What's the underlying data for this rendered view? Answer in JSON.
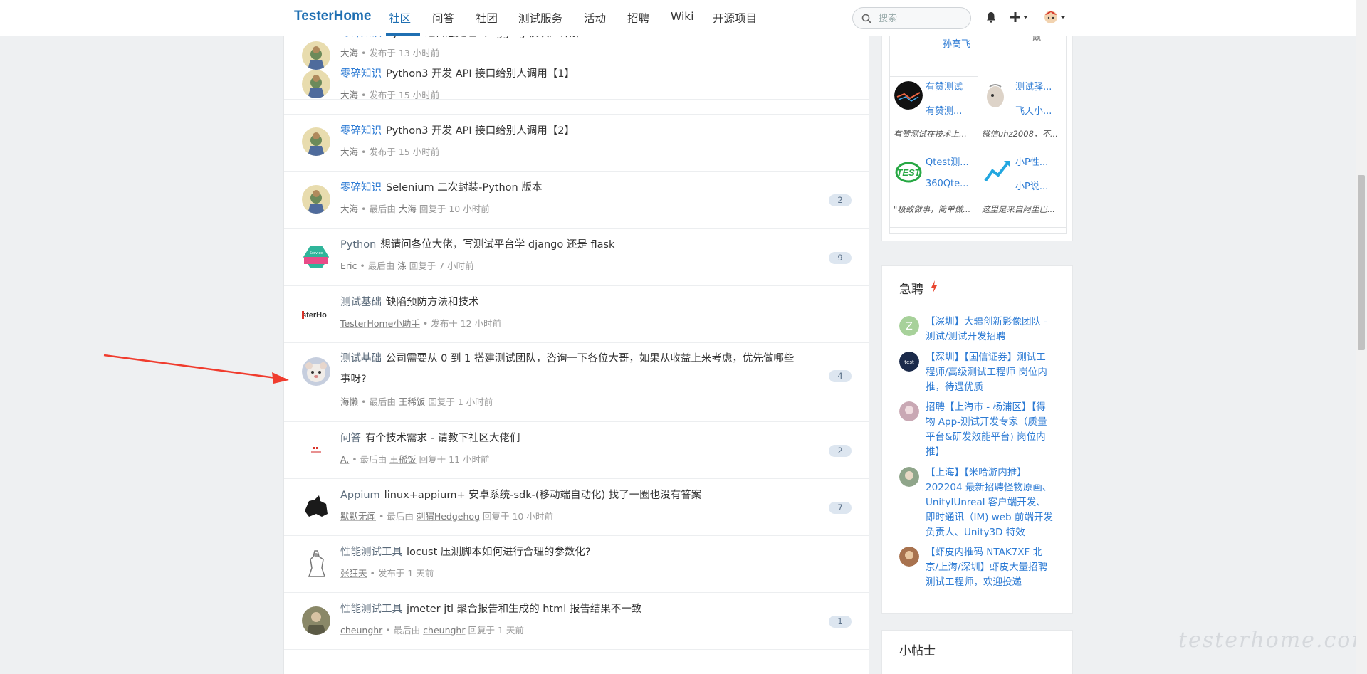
{
  "nav": {
    "brand": "TesterHome",
    "items": [
      "社区",
      "问答",
      "社团",
      "测试服务",
      "活动",
      "招聘",
      "Wiki",
      "开源项目"
    ],
    "search_placeholder": "搜索"
  },
  "topics": [
    {
      "node": "零碎知识",
      "node_style": "blue",
      "title": "Python 之日志处理（logging 模块）详解",
      "author": "大海",
      "meta": "发布于 13 小时前",
      "count": ""
    },
    {
      "node": "零碎知识",
      "node_style": "blue",
      "title": "Python3 开发 API 接口给别人调用【1】",
      "author": "大海",
      "meta": "发布于 15 小时前",
      "count": ""
    },
    {
      "node": "零碎知识",
      "node_style": "blue",
      "title": "Python3 开发 API 接口给别人调用【2】",
      "author": "大海",
      "meta": "发布于 15 小时前",
      "count": ""
    },
    {
      "node": "零碎知识",
      "node_style": "blue",
      "title": "Selenium 二次封装-Python 版本",
      "author": "大海",
      "last_reply_prefix": "最后由",
      "last_user": "大海",
      "meta": "回复于 10 小时前",
      "count": "2"
    },
    {
      "node": "Python",
      "node_style": "gray",
      "title": "想请问各位大佬，写测试平台学 django 还是 flask",
      "author": "Eric",
      "last_reply_prefix": "最后由",
      "last_user": "涤",
      "meta": "回复于 7 小时前",
      "count": "9"
    },
    {
      "node": "测试基础",
      "node_style": "gray",
      "title": "缺陷预防方法和技术",
      "author": "TesterHome小助手",
      "meta": "发布于 12 小时前",
      "count": ""
    },
    {
      "node": "测试基础",
      "node_style": "gray",
      "title": "公司需要从 0 到 1 搭建测试团队，咨询一下各位大哥，如果从收益上来考虑，优先做哪些事呀?",
      "author": "海懒",
      "last_reply_prefix": "最后由",
      "last_user": "王稀饭",
      "meta": "回复于 1 小时前",
      "count": "4"
    },
    {
      "node": "问答",
      "node_style": "gray",
      "title": "有个技术需求 - 请教下社区大佬们",
      "author": "A.",
      "last_reply_prefix": "最后由",
      "last_user": "王稀饭",
      "meta": "回复于 11 小时前",
      "count": "2"
    },
    {
      "node": "Appium",
      "node_style": "gray",
      "title": "linux+appium+ 安卓系统-sdk-(移动端自动化) 找了一圈也没有答案",
      "author": "默默无闻",
      "last_reply_prefix": "最后由",
      "last_user": "刺猬Hedgehog",
      "meta": "回复于 10 小时前",
      "count": "7"
    },
    {
      "node": "性能测试工具",
      "node_style": "gray",
      "title": "locust 压测脚本如何进行合理的参数化?",
      "author": "张狂天",
      "meta": "发布于 1 天前",
      "count": ""
    },
    {
      "node": "性能测试工具",
      "node_style": "gray",
      "title": "jmeter jtl 聚合报告和生成的 html 报告结果不一致",
      "author": "cheunghr",
      "last_reply_prefix": "最后由",
      "last_user": "cheunghr",
      "meta": "回复于 1 天前",
      "count": "1"
    }
  ],
  "ads": {
    "top_row": [
      {
        "name": "孙高飞",
        "name2": "飙"
      }
    ],
    "cells": [
      {
        "name": "有赞测试",
        "name2": "有赞测...",
        "desc": "有赞测试在技术上..."
      },
      {
        "name": "测试驿...",
        "name2": "飞天小...",
        "desc": "微信uhz2008，不..."
      },
      {
        "name": "Qtest测...",
        "name2": "360Qte...",
        "desc": "\"极致做事，简单做..."
      },
      {
        "name": "小P性...",
        "name2": "小P说...",
        "desc": "这里是来自阿里巴..."
      }
    ]
  },
  "jobs": {
    "title": "急聘",
    "items": [
      {
        "text": "【深圳】大疆创新影像团队 - 测试/测试开发招聘",
        "avatar_letter": "Z"
      },
      {
        "text": "【深圳】【国信证券】测试工程师/高级测试工程师 岗位内推，待遇优质",
        "avatar_letter": ""
      },
      {
        "text": "招聘【上海市 - 杨浦区】【得物 App-测试开发专家（质量平台&研发效能平台) 岗位内推】",
        "avatar_letter": ""
      },
      {
        "text": "【上海】【米哈游内推】202204 最新招聘怪物原画、UnityIUnreal 客户端开发、即时通讯（IM) web 前端开发负责人、Unity3D 特效",
        "avatar_letter": ""
      },
      {
        "text": "【虾皮内推码 NTAK7XF 北京/上海/深圳】虾皮大量招聘测试工程师，欢迎投递",
        "avatar_letter": ""
      }
    ]
  },
  "tips": {
    "title": "小帖士"
  },
  "watermark": "testerhome.com",
  "colors": {
    "accent": "#1f6fb2",
    "link": "#2d7bd4",
    "arrow": "#f03c2e",
    "flame": "#e8462f"
  }
}
